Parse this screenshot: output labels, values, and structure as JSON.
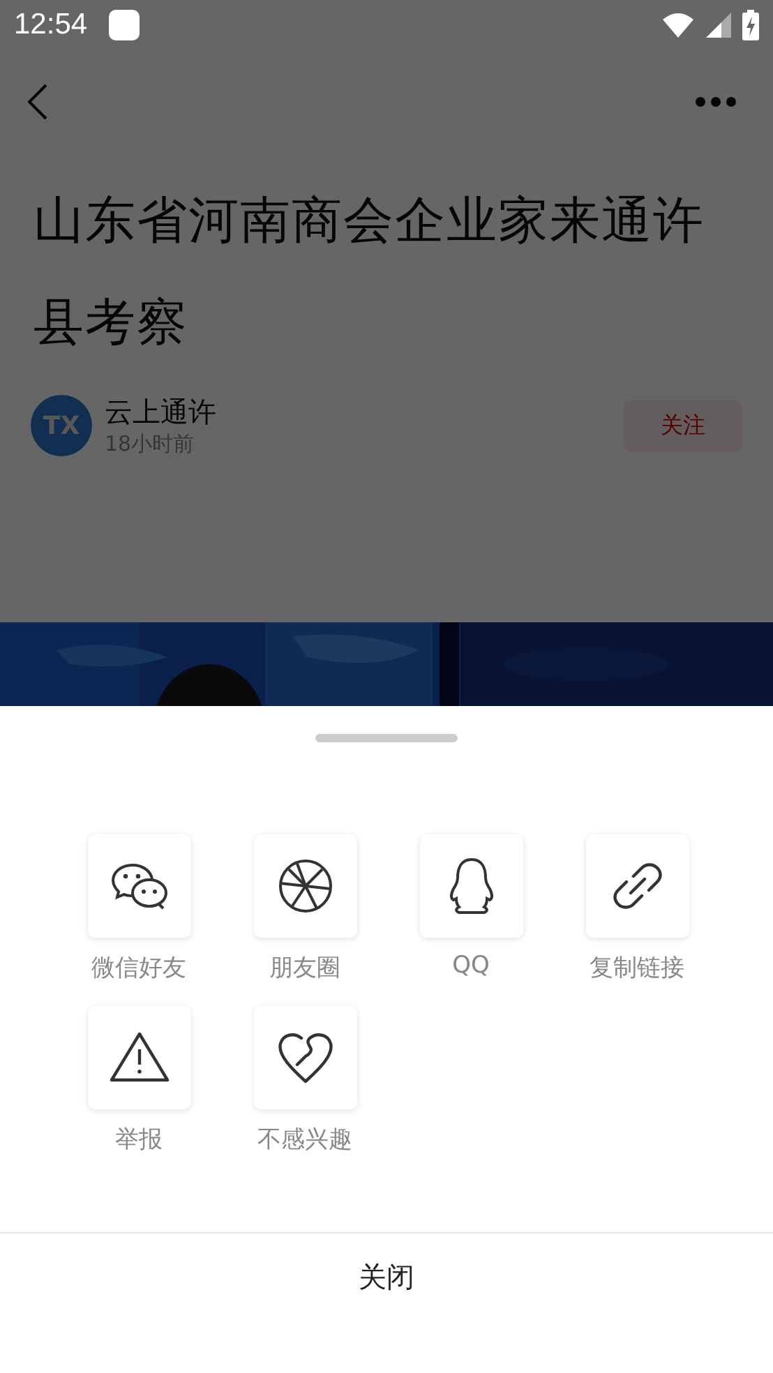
{
  "status_bar": {
    "time": "12:54"
  },
  "article": {
    "title": "山东省河南商会企业家来通许县考察",
    "author": {
      "name": "云上通许",
      "time": "18小时前",
      "avatar_text": "TX"
    },
    "follow_button": "关注"
  },
  "share_sheet": {
    "options": [
      {
        "kind": "wechat",
        "label": "微信好友"
      },
      {
        "kind": "moments",
        "label": "朋友圈"
      },
      {
        "kind": "qq",
        "label": "QQ"
      },
      {
        "kind": "link",
        "label": "复制链接"
      },
      {
        "kind": "report",
        "label": "举报"
      },
      {
        "kind": "dislike",
        "label": "不感兴趣"
      }
    ],
    "close_button": "关闭"
  }
}
